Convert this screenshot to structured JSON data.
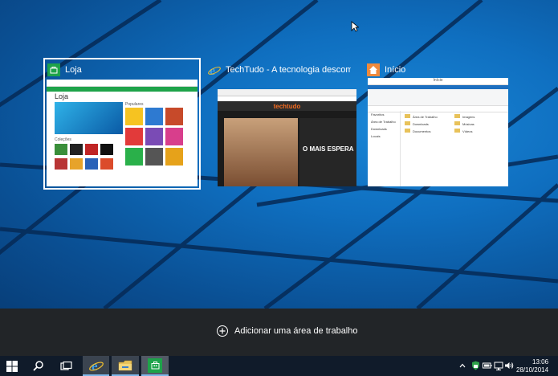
{
  "windows": [
    {
      "title": "Loja",
      "icon": "store-icon",
      "selected": true
    },
    {
      "title": "TechTudo - A tecnologia descompl...",
      "icon": "internet-explorer-icon",
      "selected": false
    },
    {
      "title": "Início",
      "icon": "file-explorer-home-icon",
      "selected": false
    }
  ],
  "previews": {
    "loja": {
      "heading": "Loja",
      "tiles": [
        "Jogos",
        "Populares",
        "Coleções",
        "Escolha"
      ],
      "section": "Coleções"
    },
    "techtudo": {
      "logo": "techtudo",
      "headline": "O MAIS ESPERA"
    },
    "inicio": {
      "title": "Início",
      "folders": [
        "Favoritos",
        "Área de Trabalho",
        "Downloads",
        "Locais"
      ],
      "items": [
        "Área de Trabalho",
        "Downloads",
        "Documentos",
        "Imagens",
        "Músicas",
        "Vídeos"
      ]
    }
  },
  "add_desktop": {
    "label": "Adicionar uma área de trabalho"
  },
  "taskbar": {
    "apps": [
      "start-icon",
      "search-icon",
      "task-view-icon",
      "internet-explorer-icon",
      "file-explorer-icon",
      "store-icon"
    ]
  },
  "clock": {
    "time": "13:06",
    "date": "28/10/2014"
  },
  "colors": {
    "accent": "#1ea34a",
    "ie_blue": "#3c9ee8",
    "explorer_orange": "#f08a3c",
    "add_bar": "#222528",
    "taskbar": "#101b2a"
  }
}
